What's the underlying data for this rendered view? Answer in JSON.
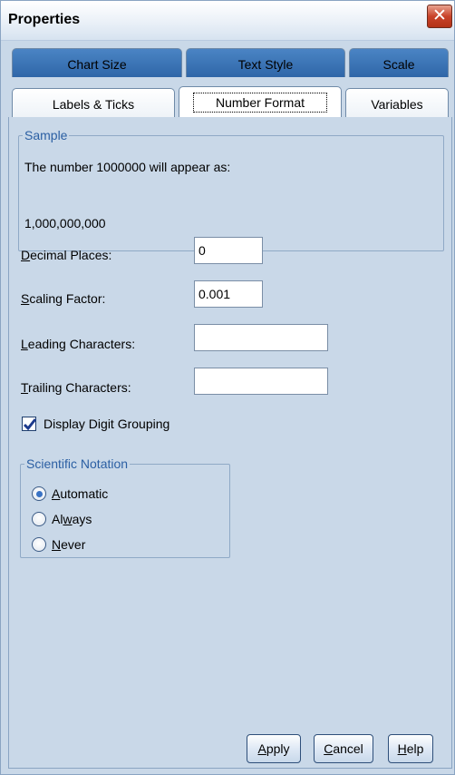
{
  "window": {
    "title": "Properties",
    "close_glyph": "✕"
  },
  "tabs": {
    "row1": [
      "Chart Size",
      "Text Style",
      "Scale"
    ],
    "row2": [
      "Labels & Ticks",
      "Number Format",
      "Variables"
    ],
    "active": "Number Format"
  },
  "sample": {
    "legend": "Sample",
    "description": "The number 1000000 will appear as:",
    "result": "1,000,000,000"
  },
  "fields": {
    "decimal_places": {
      "label_pre": "",
      "mnemonic": "D",
      "label_post": "ecimal Places:",
      "value": "0"
    },
    "scaling_factor": {
      "label_pre": "",
      "mnemonic": "S",
      "label_post": "caling Factor:",
      "value": "0.001"
    },
    "leading_characters": {
      "label_pre": "",
      "mnemonic": "L",
      "label_post": "eading Characters:",
      "value": ""
    },
    "trailing_characters": {
      "label_pre": "",
      "mnemonic": "T",
      "label_post": "railing Characters:",
      "value": ""
    }
  },
  "digit_grouping": {
    "label_pre": "Display Di",
    "mnemonic": "g",
    "label_post": "it Grouping",
    "checked": true
  },
  "scientific_notation": {
    "legend": "Scientific Notation",
    "options": [
      {
        "pre": "",
        "mnemonic": "A",
        "post": "utomatic",
        "selected": true
      },
      {
        "pre": "Al",
        "mnemonic": "w",
        "post": "ays",
        "selected": false
      },
      {
        "pre": "",
        "mnemonic": "N",
        "post": "ever",
        "selected": false
      }
    ]
  },
  "buttons": {
    "apply": {
      "mnemonic": "A",
      "rest": "pply"
    },
    "cancel": {
      "mnemonic": "C",
      "rest": "ancel"
    },
    "help": {
      "mnemonic": "H",
      "rest": "elp"
    }
  },
  "colors": {
    "dialog_bg": "#c9d8e8",
    "tab_blue": "#2f66a8",
    "legend_text": "#2b5fa3",
    "close_red": "#c9432a"
  },
  "icons": {
    "close": "close-icon",
    "checkmark": "checkmark-icon"
  }
}
